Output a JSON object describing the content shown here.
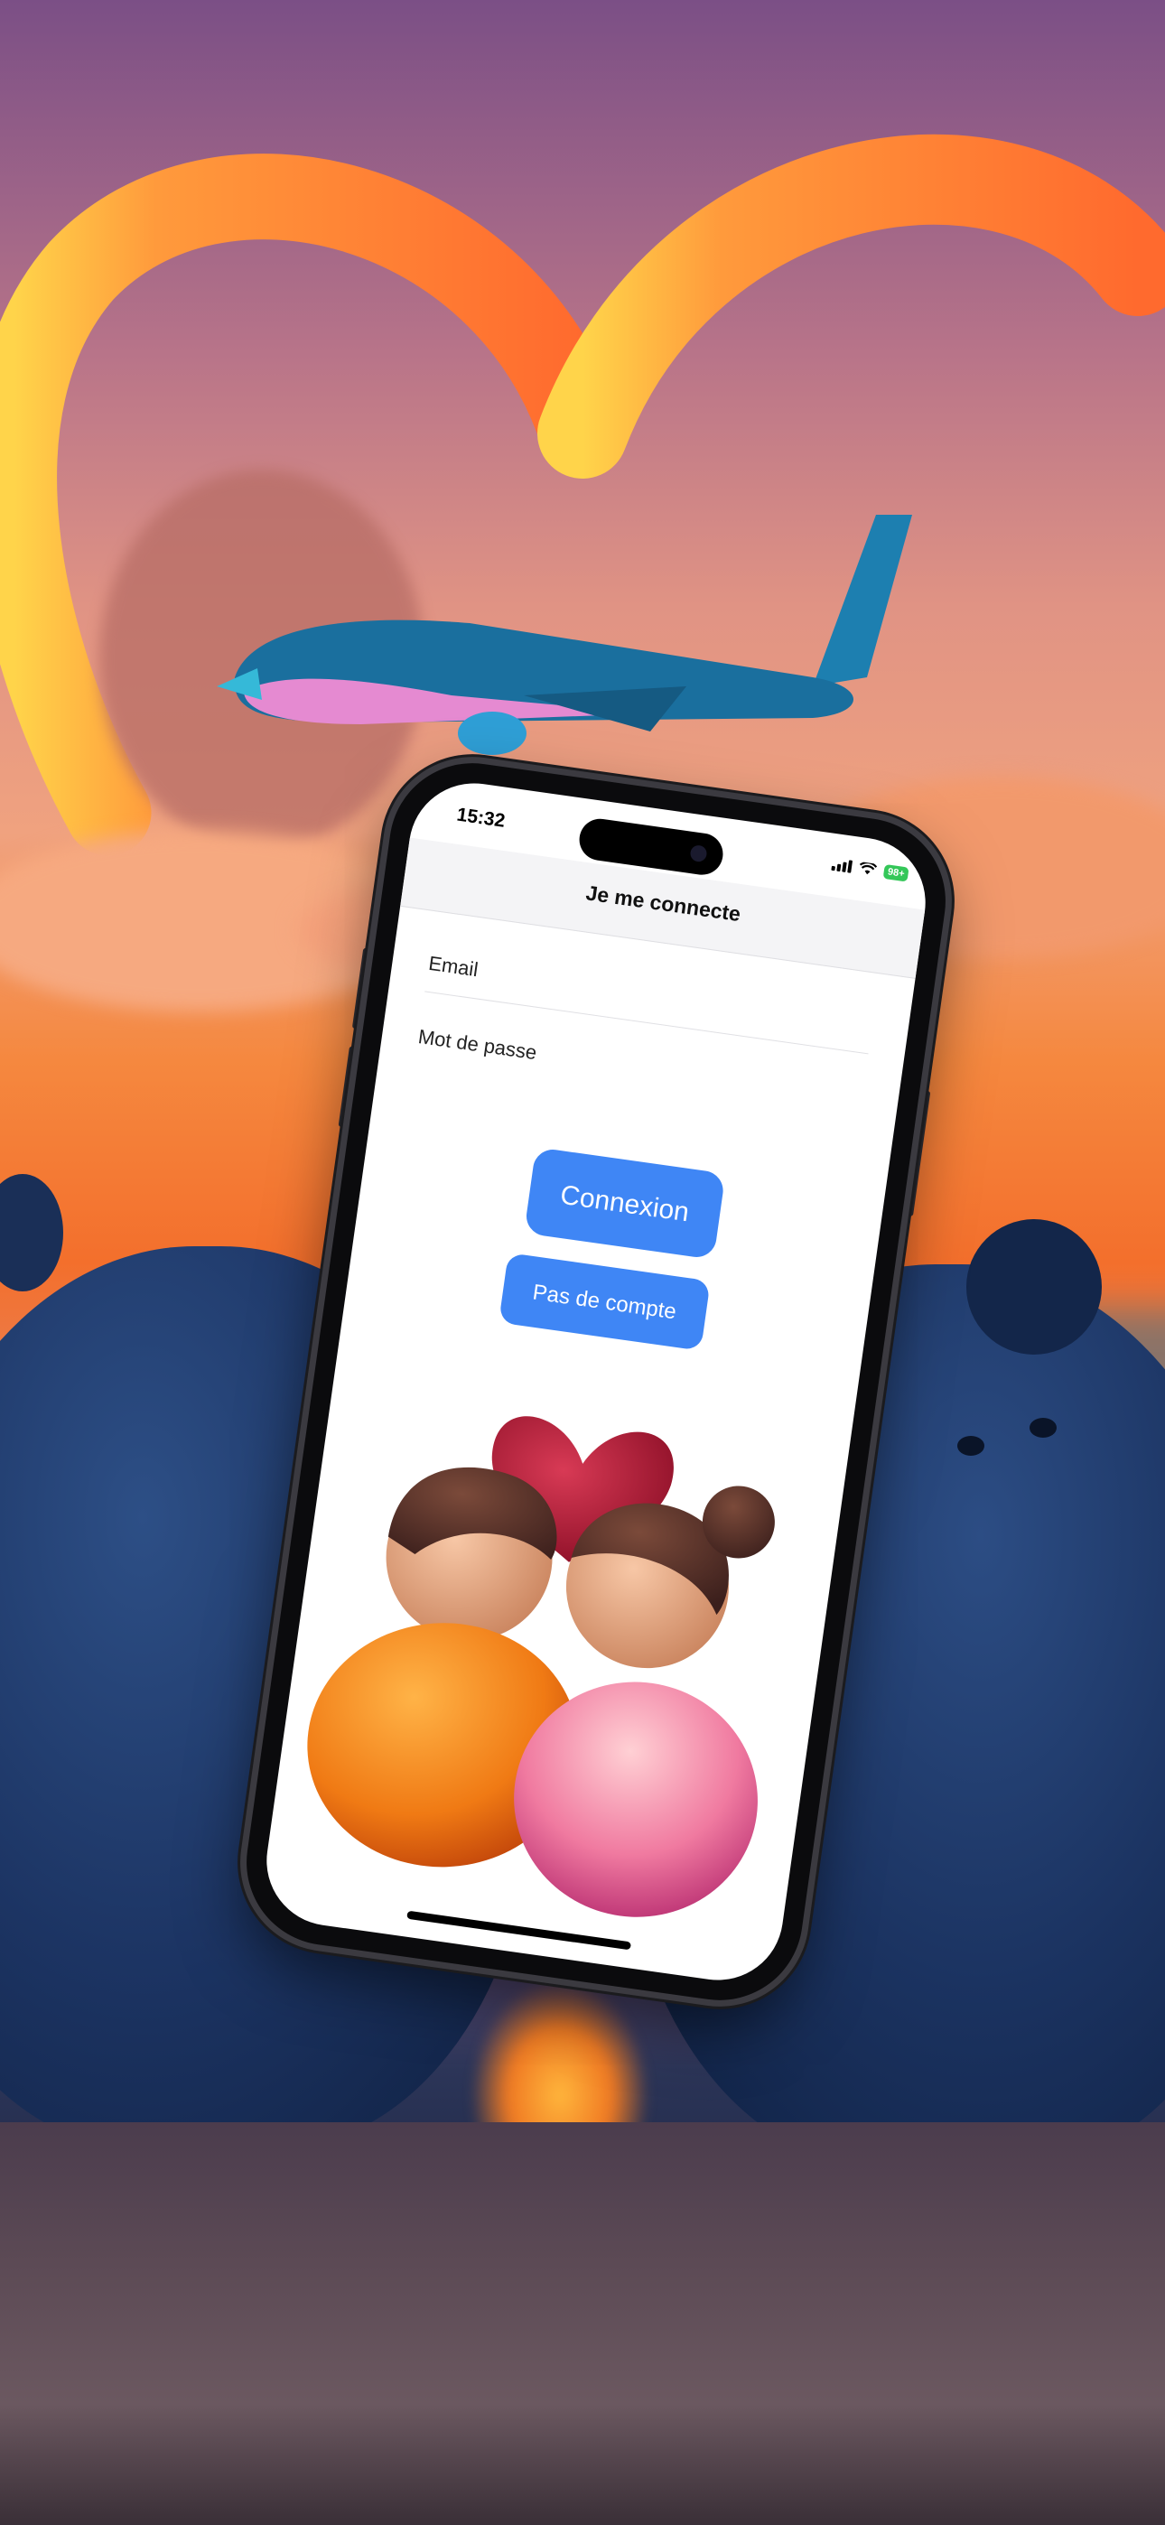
{
  "app": {
    "status_bar": {
      "time": "15:32",
      "battery": "98+"
    },
    "navbar": {
      "title": "Je me connecte"
    },
    "form": {
      "email_label": "Email",
      "password_label": "Mot de passe"
    },
    "buttons": {
      "login_label": "Connexion",
      "signup_label": "Pas de compte"
    }
  },
  "colors": {
    "accent": "#3f86f5",
    "battery": "#34c759",
    "navbar_bg": "#f4f4f6"
  },
  "icons": [
    "signal-icon",
    "wifi-icon",
    "battery-icon",
    "camera-icon"
  ]
}
